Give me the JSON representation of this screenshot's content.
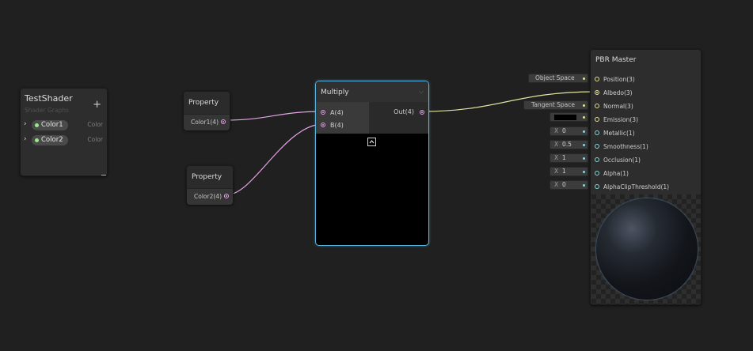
{
  "blackboard": {
    "title": "TestShader",
    "subtitle": "Shader Graphs",
    "add_label": "+",
    "properties": [
      {
        "name": "Color1",
        "type": "Color"
      },
      {
        "name": "Color2",
        "type": "Color"
      }
    ]
  },
  "property_nodes": [
    {
      "title": "Property",
      "port": "Color1(4)"
    },
    {
      "title": "Property",
      "port": "Color2(4)"
    }
  ],
  "multiply_node": {
    "title": "Multiply",
    "inputs": [
      "A(4)",
      "B(4)"
    ],
    "output": "Out(4)",
    "collapse_icon": "chevron-down-icon",
    "preview_toggle_icon": "chevron-up-icon"
  },
  "master_node": {
    "title": "PBR Master",
    "ports": [
      "Position(3)",
      "Albedo(3)",
      "Normal(3)",
      "Emission(3)",
      "Metallic(1)",
      "Smoothness(1)",
      "Occlusion(1)",
      "Alpha(1)",
      "AlphaClipThreshold(1)"
    ],
    "inline_inputs": {
      "position_space": "Object Space",
      "normal_space": "Tangent Space",
      "emission_color": "#000000",
      "metallic": {
        "axis": "X",
        "value": "0"
      },
      "smoothness": {
        "axis": "X",
        "value": "0.5"
      },
      "occlusion": {
        "axis": "X",
        "value": "1"
      },
      "alpha": {
        "axis": "X",
        "value": "1"
      },
      "alpha_clip": {
        "axis": "X",
        "value": "0"
      }
    }
  },
  "colors": {
    "background": "#202020",
    "node": "#2b2b2b",
    "selection": "#5ab4e0",
    "vector4_port": "#e5a4e7",
    "vector3_port": "#e7e39a",
    "vector1_port": "#8cd7de",
    "property_dot": "#9be88b"
  }
}
